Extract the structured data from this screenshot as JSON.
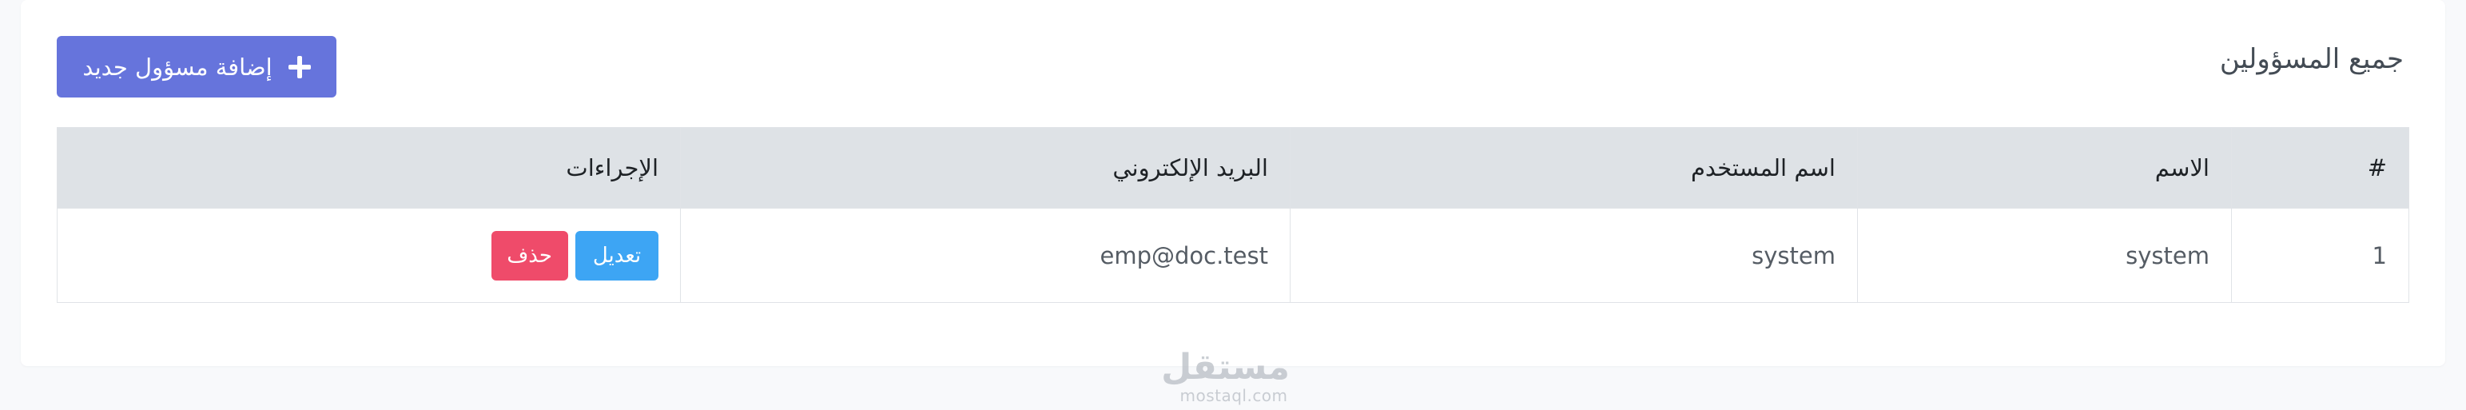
{
  "header": {
    "title": "جميع المسؤولين",
    "add_button_label": "إضافة مسؤول جديد",
    "add_button_icon": "plus-icon"
  },
  "table": {
    "columns": [
      "#",
      "الاسم",
      "اسم المستخدم",
      "البريد الإلكتروني",
      "الإجراءات"
    ],
    "rows": [
      {
        "num": "1",
        "name": "system",
        "username": "system",
        "email": "emp@doc.test",
        "actions": {
          "edit": "تعديل",
          "delete": "حذف"
        }
      }
    ]
  },
  "watermark": {
    "logo_text": "مستقل",
    "url": "mostaql.com"
  },
  "colors": {
    "primary": "#6674dc",
    "edit": "#3da5f4",
    "delete": "#ef4b6a",
    "table_header": "#dee2e6",
    "background": "#f8f9fb"
  }
}
